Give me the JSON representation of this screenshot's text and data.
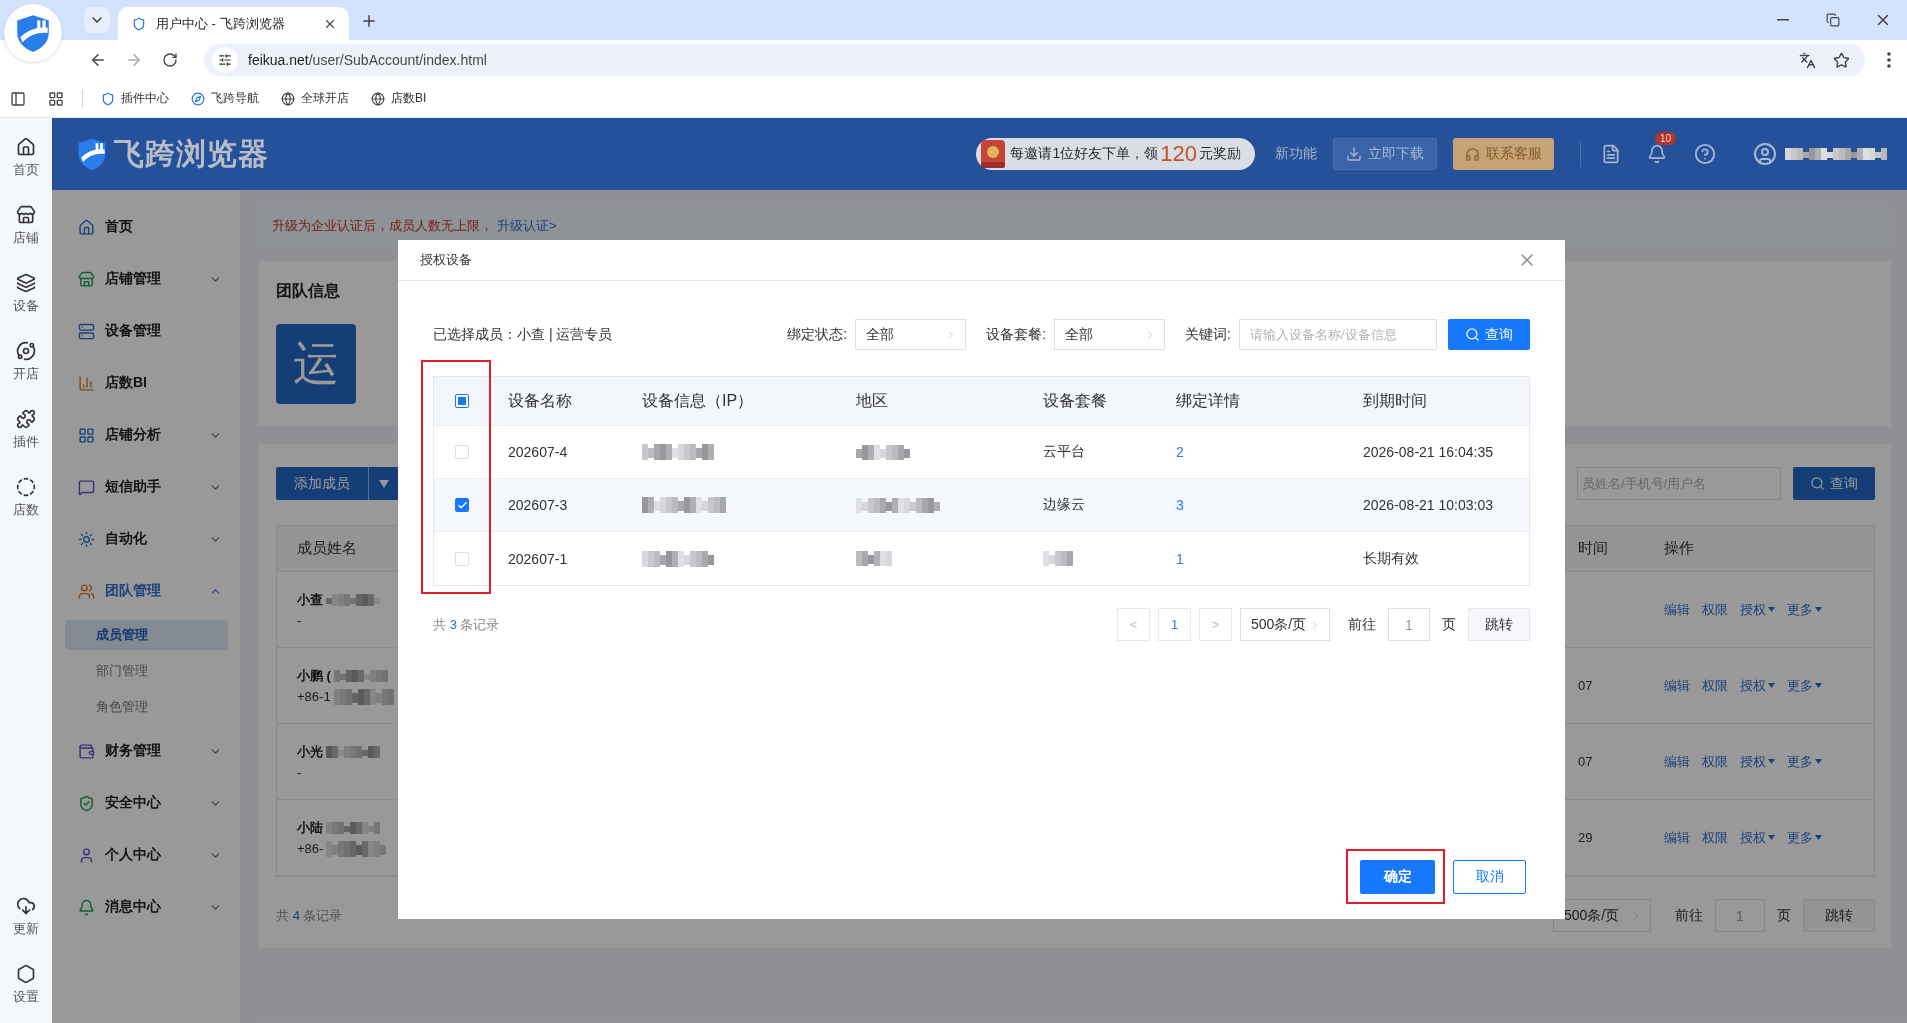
{
  "browser": {
    "tab_title": "用户中心 - 飞跨浏览器",
    "url_host": "feikua.net",
    "url_path": "/user/SubAccount/index.html",
    "bookmarks": [
      "插件中心",
      "飞跨导航",
      "全球开店",
      "店数BI"
    ]
  },
  "rail": {
    "top": [
      "首页",
      "店铺",
      "设备",
      "开店",
      "插件",
      "店数"
    ],
    "bottom": [
      "更新",
      "设置"
    ]
  },
  "header": {
    "logo": "飞跨浏览器",
    "promo": {
      "before": "每邀请1位好友下单，领",
      "amount": "120",
      "after": "元奖励"
    },
    "new_feature": "新功能",
    "download": "立即下载",
    "support": "联系客服",
    "notifications": "10"
  },
  "sidebar": {
    "items": [
      {
        "label": "首页",
        "kind": "link",
        "selected": false
      },
      {
        "label": "店铺管理",
        "kind": "group",
        "selected": false,
        "expanded": false
      },
      {
        "label": "设备管理",
        "kind": "link",
        "selected": false
      },
      {
        "label": "店数BI",
        "kind": "link",
        "selected": false
      },
      {
        "label": "店铺分析",
        "kind": "group",
        "selected": false,
        "expanded": false
      },
      {
        "label": "短信助手",
        "kind": "group",
        "selected": false,
        "expanded": false
      },
      {
        "label": "自动化",
        "kind": "group",
        "selected": false,
        "expanded": false
      },
      {
        "label": "团队管理",
        "kind": "group",
        "selected": true,
        "expanded": true,
        "children": [
          {
            "label": "成员管理",
            "selected": true
          },
          {
            "label": "部门管理",
            "selected": false
          },
          {
            "label": "角色管理",
            "selected": false
          }
        ]
      },
      {
        "label": "财务管理",
        "kind": "group",
        "selected": false,
        "expanded": false
      },
      {
        "label": "安全中心",
        "kind": "group",
        "selected": false,
        "expanded": false
      },
      {
        "label": "个人中心",
        "kind": "group",
        "selected": false,
        "expanded": false
      },
      {
        "label": "消息中心",
        "kind": "group",
        "selected": false,
        "expanded": false
      }
    ]
  },
  "notice": {
    "text": "升级为企业认证后，成员人数无上限，",
    "link": "升级认证>"
  },
  "team": {
    "title": "团队信息",
    "avatar": "运"
  },
  "members": {
    "add_button": "添加成员",
    "search_placeholder": "员姓名/手机号/用户名",
    "search_button": "查询",
    "columns": [
      "成员姓名",
      "时间",
      "操作"
    ],
    "rows": [
      {
        "name": "小查",
        "contact": "-",
        "actions": [
          {
            "label": "编辑",
            "menu": false
          },
          {
            "label": "权限",
            "menu": false
          },
          {
            "label": "授权",
            "menu": true
          },
          {
            "label": "更多",
            "menu": true
          }
        ]
      },
      {
        "name": "小鹏 (",
        "contact": "+86-1",
        "time": "07",
        "actions": [
          {
            "label": "编辑",
            "menu": false
          },
          {
            "label": "权限",
            "menu": false
          },
          {
            "label": "授权",
            "menu": true
          },
          {
            "label": "更多",
            "menu": true
          }
        ]
      },
      {
        "name": "小光",
        "contact": "-",
        "time": "07",
        "actions": [
          {
            "label": "编辑",
            "menu": false
          },
          {
            "label": "权限",
            "menu": false
          },
          {
            "label": "授权",
            "menu": true
          },
          {
            "label": "更多",
            "menu": true
          }
        ]
      },
      {
        "name": "小陆",
        "contact": "+86-",
        "time": "29",
        "actions": [
          {
            "label": "编辑",
            "menu": false
          },
          {
            "label": "权限",
            "menu": false
          },
          {
            "label": "授权",
            "menu": true
          },
          {
            "label": "更多",
            "menu": true
          }
        ]
      }
    ],
    "total_prefix": "共",
    "total": "4",
    "total_suffix": "条记录",
    "page_size": "500条/页",
    "goto": "前往",
    "page_input": "1",
    "page_unit": "页",
    "jump": "跳转"
  },
  "modal": {
    "title": "授权设备",
    "member_label": "已选择成员：",
    "member": "小查 | 运营专员",
    "filters": [
      {
        "label": "绑定状态:",
        "value": "全部"
      },
      {
        "label": "设备套餐:",
        "value": "全部"
      }
    ],
    "keyword": {
      "label": "关键词:",
      "placeholder": "请输入设备名称/设备信息"
    },
    "search": "查询",
    "columns": [
      "设备名称",
      "设备信息（IP）",
      "地区",
      "设备套餐",
      "绑定详情",
      "到期时间"
    ],
    "select_all_checked": false,
    "select_all_indeterminate": true,
    "rows": [
      {
        "selected": false,
        "name": "202607-4",
        "plan": "云平台",
        "bindings": "2",
        "expiry": "2026-08-21 16:04:35"
      },
      {
        "selected": true,
        "name": "202607-3",
        "plan": "边缘云",
        "bindings": "3",
        "expiry": "2026-08-21 10:03:03"
      },
      {
        "selected": false,
        "name": "202607-1",
        "bindings": "1",
        "expiry": "长期有效"
      }
    ],
    "total_prefix": "共",
    "total": "3",
    "total_suffix": "条记录",
    "pager": {
      "prev": "<",
      "page": "1",
      "next": ">",
      "page_size": "500条/页",
      "goto": "前往",
      "page_input": "1",
      "unit": "页",
      "jump": "跳转"
    },
    "confirm": "确定",
    "cancel": "取消",
    "annotations": {
      "checkbox_column": true,
      "confirm_button": true
    }
  }
}
